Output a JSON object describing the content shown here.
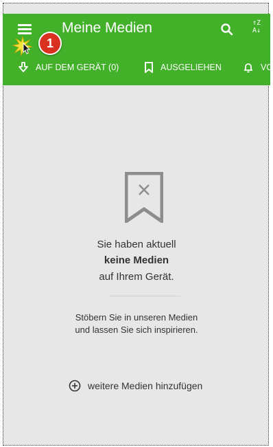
{
  "appbar": {
    "title": "Meine Medien",
    "color": "#43b02a",
    "menu_icon": "hamburger-icon",
    "search_icon": "search-icon",
    "sort_icon": "sort-alpha-icon",
    "sort_label_top": "↑Z",
    "sort_label_bottom": "A↓"
  },
  "tabs": [
    {
      "label": "AUF DEM GERÄT (0)",
      "icon": "download-icon"
    },
    {
      "label": "AUSGELIEHEN",
      "icon": "bookmark-icon"
    },
    {
      "label": "VO",
      "icon": "bell-icon"
    }
  ],
  "annotation": {
    "badge_number": "1",
    "badge_color": "#d9301f"
  },
  "empty_state": {
    "line1": "Sie haben aktuell",
    "line2": "keine Medien",
    "line3": "auf Ihrem Gerät.",
    "hint1": "Stöbern Sie in unseren Medien",
    "hint2": "und lassen Sie sich inspirieren.",
    "add_label": "weitere Medien hinzufügen"
  }
}
